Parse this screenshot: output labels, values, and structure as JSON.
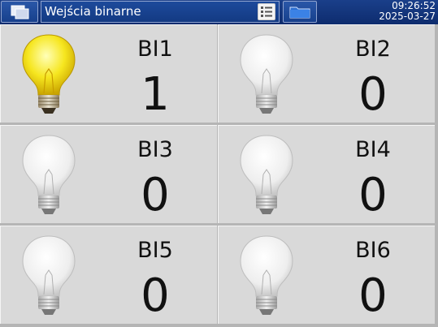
{
  "header": {
    "title": "Wejścia binarne",
    "time": "09:26:52",
    "date": "2025-03-27"
  },
  "inputs": [
    {
      "label": "BI1",
      "value": "1",
      "state": "on"
    },
    {
      "label": "BI2",
      "value": "0",
      "state": "off"
    },
    {
      "label": "BI3",
      "value": "0",
      "state": "off"
    },
    {
      "label": "BI4",
      "value": "0",
      "state": "off"
    },
    {
      "label": "BI5",
      "value": "0",
      "state": "off"
    },
    {
      "label": "BI6",
      "value": "0",
      "state": "off"
    }
  ],
  "colors": {
    "header_bg": "#13357a",
    "bulb_on": "#f3e21a",
    "bulb_off": "#f2f2f2"
  },
  "icons": {
    "window_switch": "windows-icon",
    "list": "list-icon",
    "folder": "folder-icon",
    "bulb": "light-bulb-icon"
  }
}
